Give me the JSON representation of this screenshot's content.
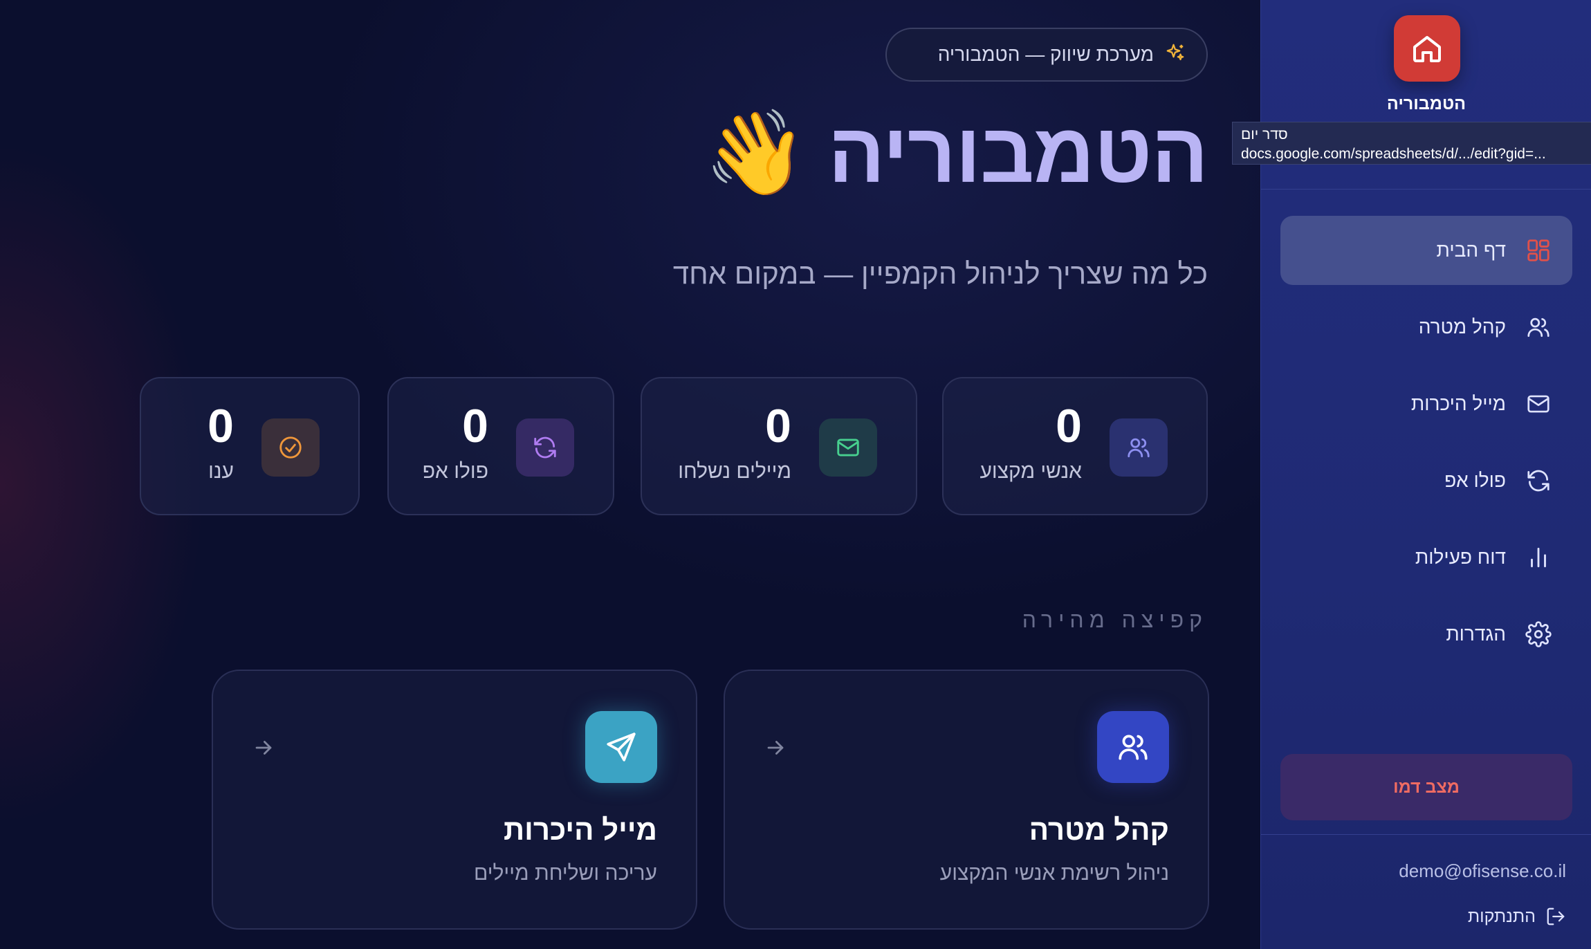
{
  "sidebar": {
    "brand_name": "הטמבוריה",
    "tooltip": {
      "title": "סדר יום",
      "url": "docs.google.com/spreadsheets/d/.../edit?gid=..."
    },
    "nav": [
      {
        "label": "דף הבית",
        "icon": "grid-icon",
        "active": true
      },
      {
        "label": "קהל מטרה",
        "icon": "users-icon"
      },
      {
        "label": "מייל היכרות",
        "icon": "mail-icon"
      },
      {
        "label": "פולו אפ",
        "icon": "refresh-icon"
      },
      {
        "label": "דוח פעילות",
        "icon": "bar-chart-icon"
      },
      {
        "label": "הגדרות",
        "icon": "gear-icon"
      }
    ],
    "demo_button": "מצב דמו",
    "user_email": "demo@ofisense.co.il",
    "logout_label": "התנתקות"
  },
  "header": {
    "pill_label": "מערכת שיווק — הטמבוריה",
    "title": "הטמבוריה",
    "wave_emoji": "👋",
    "subtitle": "כל מה שצריך לניהול הקמפיין — במקום אחד"
  },
  "stats": [
    {
      "value": "0",
      "label": "אנשי מקצוע",
      "icon": "users-icon"
    },
    {
      "value": "0",
      "label": "מיילים נשלחו",
      "icon": "mail-icon"
    },
    {
      "value": "0",
      "label": "פולו אפ",
      "icon": "refresh-icon"
    },
    {
      "value": "0",
      "label": "ענו",
      "icon": "check-circle-icon"
    }
  ],
  "quick": {
    "section_title": "קפיצה מהירה",
    "cards": [
      {
        "title": "קהל מטרה",
        "desc": "ניהול רשימת אנשי המקצוע",
        "icon": "users-icon"
      },
      {
        "title": "מייל היכרות",
        "desc": "עריכה ושליחת מיילים",
        "icon": "send-icon"
      }
    ]
  },
  "colors": {
    "accent_red": "#d13b36",
    "hero_purple": "#b9b4f4",
    "sidebar_bg": "#222d7c",
    "demo_text": "#ef6b62"
  }
}
